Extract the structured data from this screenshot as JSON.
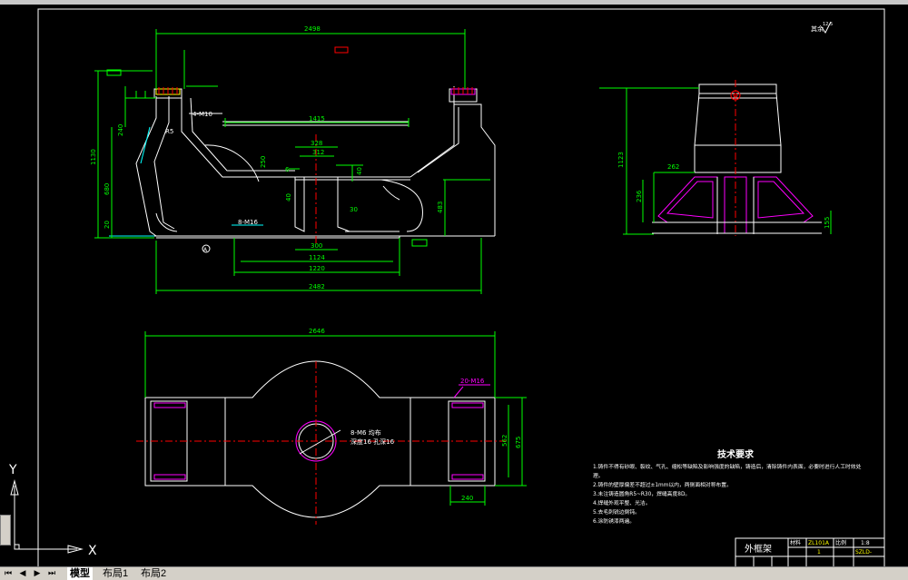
{
  "colors": {
    "background": "#000000",
    "outline": "#ffffff",
    "dimension": "#00ff00",
    "centerline": "#ff0000",
    "section": "#ff00ff",
    "leader": "#00ffff",
    "annotation": "#ffff00"
  },
  "front_view": {
    "dims": {
      "top_span": "2498",
      "top_flange_width": "1415",
      "inner_top": "328",
      "inner_mid": "312",
      "bottom_inner": "300",
      "bottom_1124": "1124",
      "bottom_1220": "1220",
      "overall": "2482",
      "height_1130": "1130",
      "height_680": "680",
      "height_240": "240",
      "right_height": "483",
      "dim_40a": "40",
      "dim_40b": "40",
      "dim_30": "30",
      "dim_250": "250",
      "dim_20": "20",
      "dim_6": "6"
    },
    "labels": {
      "hole_note": "4-M10",
      "thread_note": "8-M16",
      "datum_tag": "A",
      "radius_label": "R5"
    }
  },
  "side_view": {
    "dims": {
      "height": "1123",
      "width_262": "262",
      "dim_236": "236",
      "dim_155": "155"
    }
  },
  "top_view": {
    "dims": {
      "overall": "2646",
      "width_562": "562",
      "width_675": "675",
      "pad_240": "240"
    },
    "labels": {
      "thread_right": "20-M16",
      "hole_note_1": "8-M6 均布",
      "hole_note_2": "深度16 孔深16"
    }
  },
  "tech_requirements": {
    "title": "技术要求",
    "lines": [
      "1.铸件不得有砂眼、裂纹、气孔、缩松等缺陷及影响强度的缺陷，铸造后，清除铸件内表面，必要时进行人工时效处",
      "理。",
      "2.铸件的壁厚偏差不超过±1mm以内，两侧面相对称布置。",
      "3.未注铸造圆角R5~R30，焊缝高度8D。",
      "4.焊缝外观平整、光洁。",
      "5.去毛刺锐边倒钝。",
      "6.涂防锈漆两遍。"
    ]
  },
  "title_block": {
    "part_name": "外框架",
    "drawing_no": "ZL101A",
    "quantity": "1",
    "scale": "1:8",
    "material": "SZLD-",
    "label_material": "材料",
    "label_scale": "比例"
  },
  "roughness_note": "其余",
  "roughness_value": "12.5",
  "layout_tabs": [
    "模型",
    "布局1",
    "布局2"
  ],
  "active_tab": "模型",
  "ucs": {
    "y": "Y",
    "x": "X"
  }
}
